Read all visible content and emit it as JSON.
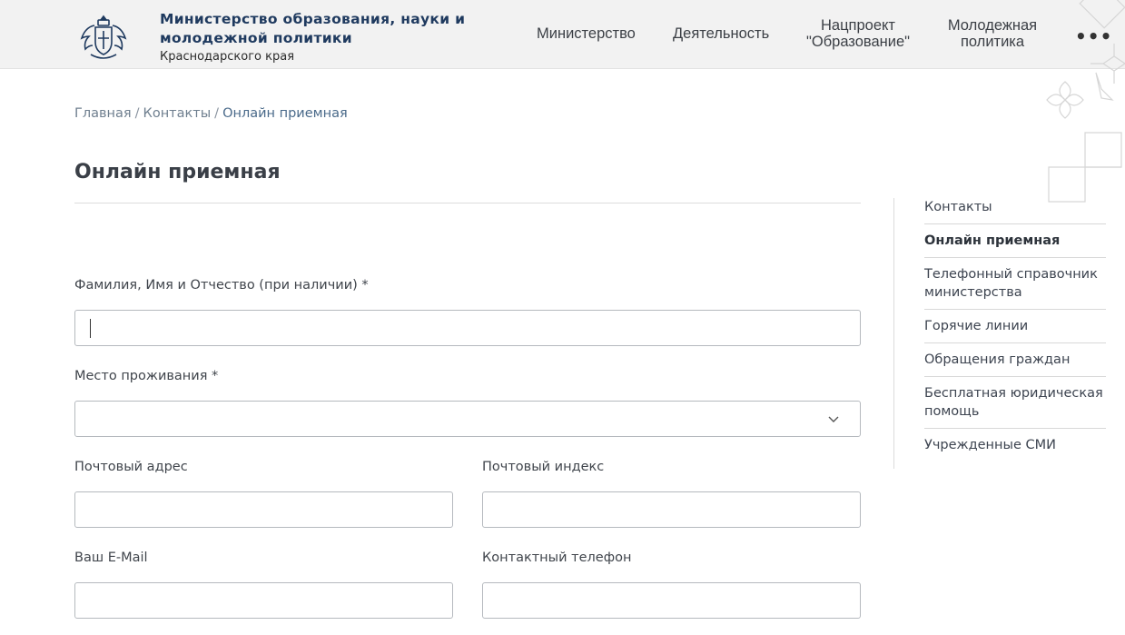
{
  "header": {
    "org_name_line1": "Министерство образования, науки и",
    "org_name_line2": "молодежной политики",
    "org_region": "Краснодарского края",
    "nav": [
      {
        "line1": "Министерство",
        "line2": ""
      },
      {
        "line1": "Деятельность",
        "line2": ""
      },
      {
        "line1": "Нацпроект",
        "line2": "\"Образование\""
      },
      {
        "line1": "Молодежная",
        "line2": "политика"
      }
    ],
    "more_label": "•••"
  },
  "breadcrumb": {
    "home": "Главная",
    "contacts": "Контакты",
    "current": "Онлайн приемная",
    "separator": "/"
  },
  "page_title": "Онлайн приемная",
  "form": {
    "fio_label": "Фамилия, Имя и Отчество (при наличии) *",
    "fio_value": "",
    "residence_label": "Место проживания *",
    "residence_value": "",
    "postal_address_label": "Почтовый адрес",
    "postal_index_label": "Почтовый индекс",
    "email_label": "Ваш E-Mail",
    "phone_label": "Контактный телефон"
  },
  "sidebar": {
    "items": [
      {
        "label": "Контакты",
        "active": false
      },
      {
        "label": "Онлайн приемная",
        "active": true
      },
      {
        "label": "Телефонный справочник министерства",
        "active": false
      },
      {
        "label": "Горячие линии",
        "active": false
      },
      {
        "label": "Обращения граждан",
        "active": false
      },
      {
        "label": "Бесплатная юридическая помощь",
        "active": false
      },
      {
        "label": "Учрежденные СМИ",
        "active": false
      }
    ]
  },
  "colors": {
    "header_bg": "#f2f2f2",
    "org_name": "#1f3a5f",
    "border": "#b5b9be"
  }
}
